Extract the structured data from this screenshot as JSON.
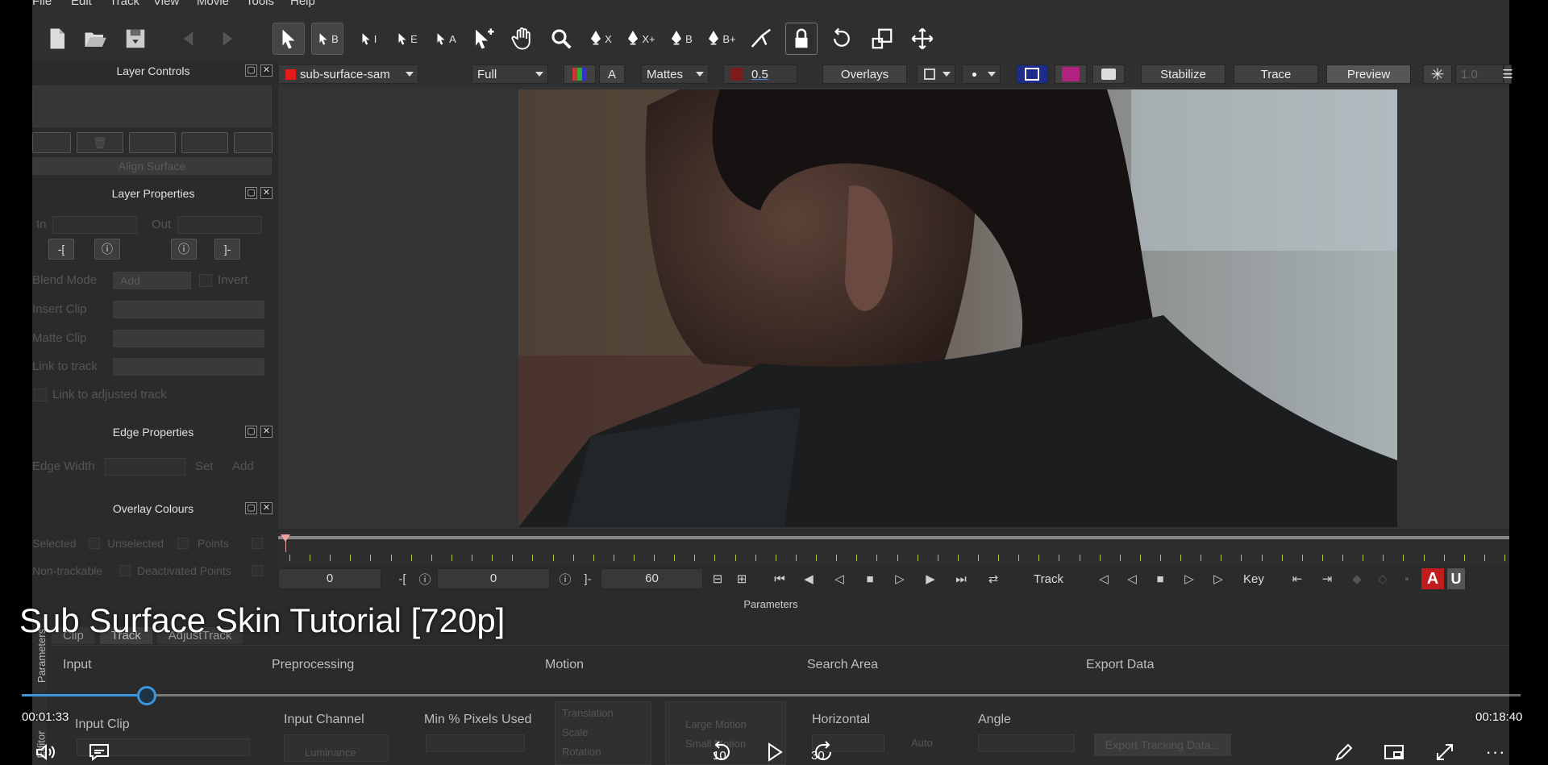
{
  "menu": [
    "File",
    "Edit",
    "Track",
    "View",
    "Movie",
    "Tools",
    "Help"
  ],
  "toolbar": {
    "select_b": "B",
    "select_i": "I",
    "select_e": "E",
    "select_a": "A",
    "pen_x": "X",
    "pen_xplus": "X+",
    "pen_b": "B",
    "pen_bplus": "B+"
  },
  "viewer_header": {
    "layer_name": "sub-surface-sam",
    "layer_color": "#e21b1b",
    "resolution": "Full",
    "channel_a": "A",
    "mattes": "Mattes",
    "opacity": "0.5",
    "overlays": "Overlays",
    "stabilize": "Stabilize",
    "trace": "Trace",
    "preview": "Preview",
    "zoom_value": "1.0",
    "swatch_color": "#b0227e"
  },
  "left_panel": {
    "layer_controls": "Layer Controls",
    "align_surface": "Align Surface",
    "layer_properties": "Layer Properties",
    "in_label": "In",
    "out_label": "Out",
    "blend_mode_label": "Blend Mode",
    "blend_mode_value": "Add",
    "invert_label": "Invert",
    "insert_clip_label": "Insert Clip",
    "matte_clip_label": "Matte Clip",
    "link_to_track_label": "Link to track",
    "link_adjusted_label": "Link to adjusted track",
    "edge_properties": "Edge Properties",
    "edge_width_label": "Edge Width",
    "set_label": "Set",
    "add_label": "Add",
    "overlay_colours": "Overlay Colours",
    "selected_label": "Selected",
    "unselected_label": "Unselected",
    "points_label": "Points",
    "non_trackable_label": "Non-trackable",
    "deactivated_points_label": "Deactivated Points"
  },
  "timeline_controls": {
    "current_frame": "0",
    "in_frame": "0",
    "out_frame": "60",
    "track_label": "Track",
    "key_label": "Key"
  },
  "params": {
    "panel_title": "Parameters",
    "side_label": "Parameters",
    "tabs": [
      "Clip",
      "Track",
      "AdjustTrack"
    ],
    "sections": [
      "Input",
      "Preprocessing",
      "Motion",
      "Search Area",
      "Export Data"
    ],
    "input_clip": "Input Clip",
    "input_channel": "Input Channel",
    "luminance": "Luminance",
    "min_pixels": "Min % Pixels Used",
    "translation": "Translation",
    "scale": "Scale",
    "rotation": "Rotation",
    "large_motion": "Large Motion",
    "small_motion": "Small Motion",
    "horizontal": "Horizontal",
    "angle": "Angle",
    "auto": "Auto",
    "export_tracking": "Export Tracking Data...",
    "editor_label": "Editor"
  },
  "player": {
    "title": "Sub Surface Skin Tutorial [720p]",
    "elapsed": "00:01:33",
    "duration": "00:18:40",
    "progress": 0.0835,
    "skip_back": "10",
    "skip_forward": "30",
    "accent": "#3a96dd"
  }
}
